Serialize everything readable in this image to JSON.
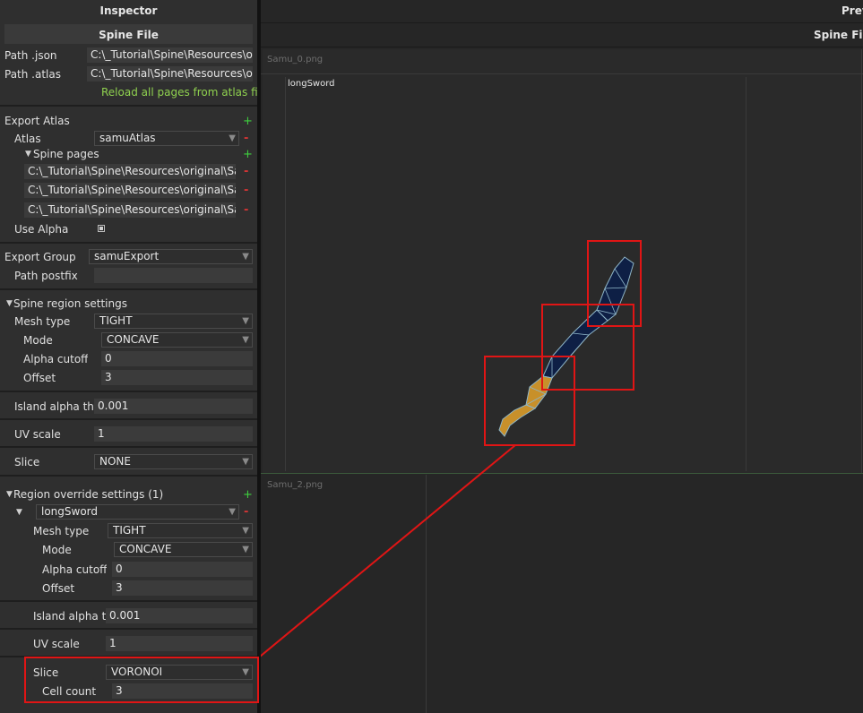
{
  "inspector": {
    "title": "Inspector",
    "spine_file": {
      "header": "Spine File",
      "path_json_label": "Path .json",
      "path_json_value": "C:\\_Tutorial\\Spine\\Resources\\orig",
      "path_atlas_label": "Path .atlas",
      "path_atlas_value": "C:\\_Tutorial\\Spine\\Resources\\orig",
      "reload_link": "Reload all pages from atlas file"
    },
    "export_atlas": {
      "label": "Export Atlas",
      "atlas_label": "Atlas",
      "atlas_value": "samuAtlas",
      "spine_pages_label": "Spine pages",
      "pages": [
        "C:\\_Tutorial\\Spine\\Resources\\original\\Sam",
        "C:\\_Tutorial\\Spine\\Resources\\original\\Sam",
        "C:\\_Tutorial\\Spine\\Resources\\original\\Sam"
      ],
      "use_alpha_label": "Use Alpha"
    },
    "export_group": {
      "label": "Export Group",
      "value": "samuExport",
      "path_postfix_label": "Path postfix",
      "path_postfix_value": ""
    },
    "region_settings": {
      "header": "Spine region settings",
      "mesh_type_label": "Mesh type",
      "mesh_type_value": "TIGHT",
      "mode_label": "Mode",
      "mode_value": "CONCAVE",
      "alpha_cutoff_label": "Alpha cutoff",
      "alpha_cutoff_value": "0",
      "offset_label": "Offset",
      "offset_value": "3",
      "island_label": "Island alpha thre",
      "island_value": "0.001",
      "uv_scale_label": "UV scale",
      "uv_scale_value": "1",
      "slice_label": "Slice",
      "slice_value": "NONE"
    },
    "override": {
      "header": "Region override settings (1)",
      "region_value": "longSword",
      "mesh_type_label": "Mesh type",
      "mesh_type_value": "TIGHT",
      "mode_label": "Mode",
      "mode_value": "CONCAVE",
      "alpha_cutoff_label": "Alpha cutoff",
      "alpha_cutoff_value": "0",
      "offset_label": "Offset",
      "offset_value": "3",
      "island_label": "Island alpha th",
      "island_value": "0.001",
      "uv_scale_label": "UV scale",
      "uv_scale_value": "1",
      "slice_label": "Slice",
      "slice_value": "VORONOI",
      "cell_count_label": "Cell count",
      "cell_count_value": "3"
    }
  },
  "preview": {
    "title": "Prev",
    "subtitle": "Spine File",
    "sheet1": "Samu_0.png",
    "region_label": "longSword",
    "sheet2": "Samu_2.png"
  },
  "icons": {
    "plus": "+",
    "minus": "-",
    "arrow": "▼",
    "triangle": "▼"
  },
  "colors": {
    "highlight": "#e01515",
    "link": "#8fd14f",
    "plus": "#3ecf3e",
    "minus": "#d23535",
    "mesh_fill": "#0e1f45",
    "mesh_stroke": "#8fb6c8",
    "mesh_gold": "#c8902a"
  }
}
